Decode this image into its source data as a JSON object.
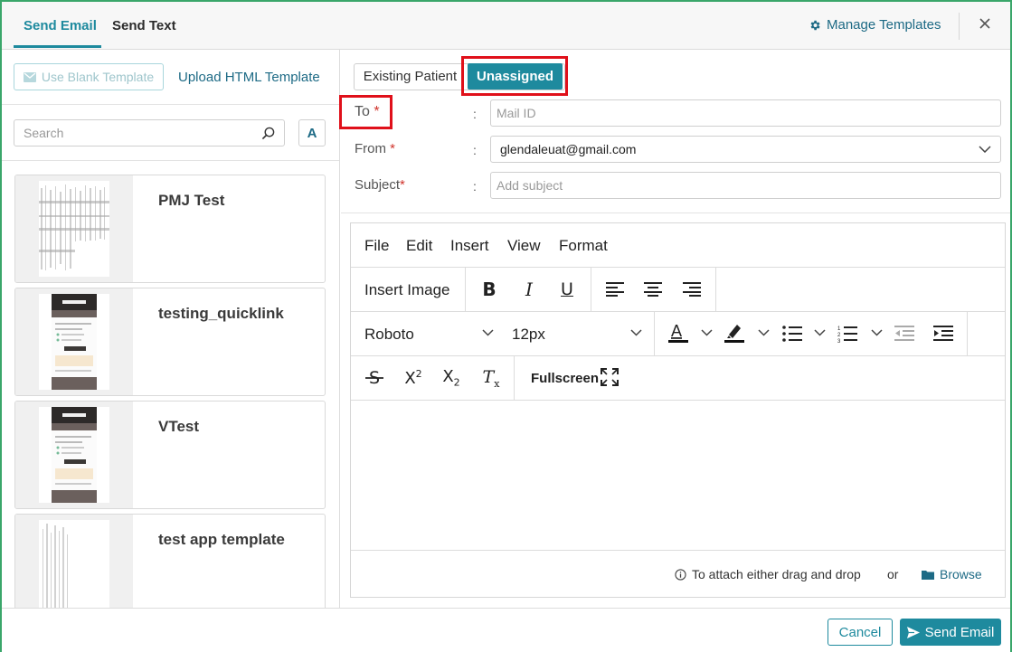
{
  "tabs": [
    {
      "label": "Send Email",
      "active": true
    },
    {
      "label": "Send Text",
      "active": false
    }
  ],
  "header": {
    "manage_templates_label": "Manage Templates",
    "manage_icon": "gear-icon",
    "close_icon": "close-icon"
  },
  "left_panel": {
    "use_blank_label": "Use Blank Template",
    "upload_label": "Upload HTML Template",
    "search_placeholder": "Search",
    "filter_label": "A",
    "templates": [
      {
        "name": "PMJ Test"
      },
      {
        "name": "testing_quicklink"
      },
      {
        "name": "VTest"
      },
      {
        "name": "test app template"
      }
    ]
  },
  "recipient_toggle": {
    "options": [
      "Existing Patient",
      "Unassigned"
    ],
    "selected": "Unassigned"
  },
  "form": {
    "to_label": "To",
    "to_placeholder": "Mail ID",
    "from_label": "From",
    "from_value": "glendaleuat@gmail.com",
    "subject_label": "Subject",
    "subject_placeholder": "Add subject",
    "required_mark": "*",
    "colon": ":"
  },
  "editor": {
    "menu": [
      "File",
      "Edit",
      "Insert",
      "View",
      "Format"
    ],
    "insert_image_label": "Insert Image",
    "font_family": "Roboto",
    "font_size": "12px",
    "fullscreen_label": "Fullscreen",
    "attach_text": "To attach either drag and drop",
    "or_text": "or",
    "browse_label": "Browse"
  },
  "footer": {
    "cancel_label": "Cancel",
    "send_label": "Send Email"
  },
  "colors": {
    "accent": "#1e8a9e",
    "link": "#1d6a85",
    "highlight_box": "#e0101a",
    "frame_border": "#3aa66a",
    "required": "#d0342c"
  }
}
